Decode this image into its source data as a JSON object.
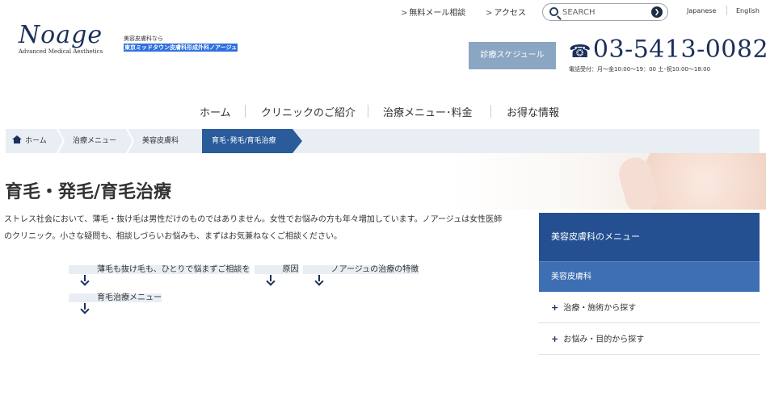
{
  "topbar": {
    "links": [
      {
        "label": "無料メール相談"
      },
      {
        "label": "アクセス"
      }
    ],
    "search": {
      "placeholder": "SEARCH"
    },
    "languages": [
      "Japanese",
      "English"
    ]
  },
  "brand": {
    "logo_text": "Noage",
    "logo_tagline": "Advanced Medical Aesthetics",
    "tagline_line1": "美容皮膚科なら",
    "tagline_line2": "東京ミッドタウン皮膚科形成外科ノアージュ"
  },
  "contact": {
    "schedule_button": "診療スケジュール",
    "phone": "03-5413-0082",
    "hours": "電話受付：月〜金10:00〜19：00 土･祝10:00〜18:00"
  },
  "global_nav": [
    "ホーム",
    "クリニックのご紹介",
    "治療メニュー･料金",
    "お得な情報"
  ],
  "breadcrumb": [
    "ホーム",
    "治療メニュー",
    "美容皮膚科",
    "育毛･発毛/育毛治療"
  ],
  "page": {
    "title": "育毛・発毛/育毛治療",
    "intro": "ストレス社会において、薄毛・抜け毛は男性だけのものではありません。女性でお悩みの方も年々増加しています。ノアージュは女性医師のクリニック。小さな疑問も、相談しづらいお悩みも、まずはお気兼ねなくご相談ください。"
  },
  "anchors": [
    "薄毛も抜け毛も、ひとりで悩まずご相談を",
    "原因",
    "ノアージュの治療の特徴",
    "育毛治療メニュー"
  ],
  "sidebar": {
    "heading": "美容皮膚科のメニュー",
    "current": "美容皮膚科",
    "items": [
      "治療・施術から探す",
      "お悩み・目的から探す"
    ]
  },
  "colors": {
    "brand_navy": "#1b2f5a",
    "active_blue": "#2a5b9b",
    "sidebar_head": "#245092",
    "light_panel": "#e8eef4"
  }
}
